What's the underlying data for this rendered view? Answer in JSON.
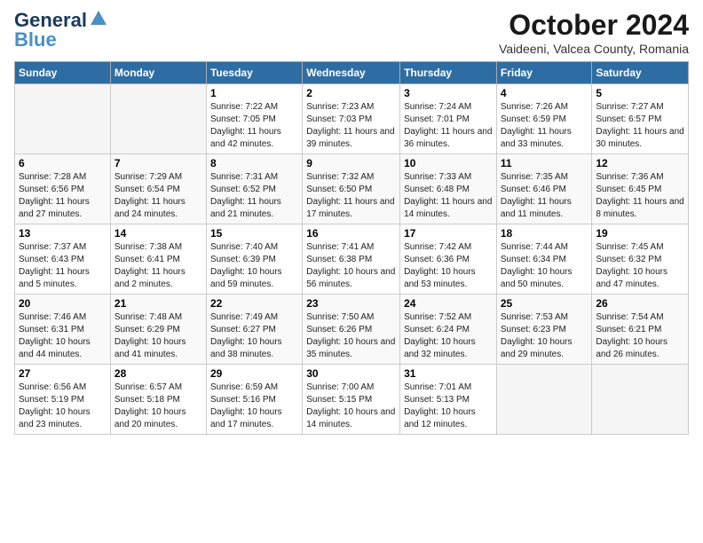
{
  "header": {
    "logo_general": "General",
    "logo_blue": "Blue",
    "month_title": "October 2024",
    "location": "Vaideeni, Valcea County, Romania"
  },
  "weekdays": [
    "Sunday",
    "Monday",
    "Tuesday",
    "Wednesday",
    "Thursday",
    "Friday",
    "Saturday"
  ],
  "weeks": [
    [
      {
        "day": "",
        "sunrise": "",
        "sunset": "",
        "daylight": ""
      },
      {
        "day": "",
        "sunrise": "",
        "sunset": "",
        "daylight": ""
      },
      {
        "day": "1",
        "sunrise": "Sunrise: 7:22 AM",
        "sunset": "Sunset: 7:05 PM",
        "daylight": "Daylight: 11 hours and 42 minutes."
      },
      {
        "day": "2",
        "sunrise": "Sunrise: 7:23 AM",
        "sunset": "Sunset: 7:03 PM",
        "daylight": "Daylight: 11 hours and 39 minutes."
      },
      {
        "day": "3",
        "sunrise": "Sunrise: 7:24 AM",
        "sunset": "Sunset: 7:01 PM",
        "daylight": "Daylight: 11 hours and 36 minutes."
      },
      {
        "day": "4",
        "sunrise": "Sunrise: 7:26 AM",
        "sunset": "Sunset: 6:59 PM",
        "daylight": "Daylight: 11 hours and 33 minutes."
      },
      {
        "day": "5",
        "sunrise": "Sunrise: 7:27 AM",
        "sunset": "Sunset: 6:57 PM",
        "daylight": "Daylight: 11 hours and 30 minutes."
      }
    ],
    [
      {
        "day": "6",
        "sunrise": "Sunrise: 7:28 AM",
        "sunset": "Sunset: 6:56 PM",
        "daylight": "Daylight: 11 hours and 27 minutes."
      },
      {
        "day": "7",
        "sunrise": "Sunrise: 7:29 AM",
        "sunset": "Sunset: 6:54 PM",
        "daylight": "Daylight: 11 hours and 24 minutes."
      },
      {
        "day": "8",
        "sunrise": "Sunrise: 7:31 AM",
        "sunset": "Sunset: 6:52 PM",
        "daylight": "Daylight: 11 hours and 21 minutes."
      },
      {
        "day": "9",
        "sunrise": "Sunrise: 7:32 AM",
        "sunset": "Sunset: 6:50 PM",
        "daylight": "Daylight: 11 hours and 17 minutes."
      },
      {
        "day": "10",
        "sunrise": "Sunrise: 7:33 AM",
        "sunset": "Sunset: 6:48 PM",
        "daylight": "Daylight: 11 hours and 14 minutes."
      },
      {
        "day": "11",
        "sunrise": "Sunrise: 7:35 AM",
        "sunset": "Sunset: 6:46 PM",
        "daylight": "Daylight: 11 hours and 11 minutes."
      },
      {
        "day": "12",
        "sunrise": "Sunrise: 7:36 AM",
        "sunset": "Sunset: 6:45 PM",
        "daylight": "Daylight: 11 hours and 8 minutes."
      }
    ],
    [
      {
        "day": "13",
        "sunrise": "Sunrise: 7:37 AM",
        "sunset": "Sunset: 6:43 PM",
        "daylight": "Daylight: 11 hours and 5 minutes."
      },
      {
        "day": "14",
        "sunrise": "Sunrise: 7:38 AM",
        "sunset": "Sunset: 6:41 PM",
        "daylight": "Daylight: 11 hours and 2 minutes."
      },
      {
        "day": "15",
        "sunrise": "Sunrise: 7:40 AM",
        "sunset": "Sunset: 6:39 PM",
        "daylight": "Daylight: 10 hours and 59 minutes."
      },
      {
        "day": "16",
        "sunrise": "Sunrise: 7:41 AM",
        "sunset": "Sunset: 6:38 PM",
        "daylight": "Daylight: 10 hours and 56 minutes."
      },
      {
        "day": "17",
        "sunrise": "Sunrise: 7:42 AM",
        "sunset": "Sunset: 6:36 PM",
        "daylight": "Daylight: 10 hours and 53 minutes."
      },
      {
        "day": "18",
        "sunrise": "Sunrise: 7:44 AM",
        "sunset": "Sunset: 6:34 PM",
        "daylight": "Daylight: 10 hours and 50 minutes."
      },
      {
        "day": "19",
        "sunrise": "Sunrise: 7:45 AM",
        "sunset": "Sunset: 6:32 PM",
        "daylight": "Daylight: 10 hours and 47 minutes."
      }
    ],
    [
      {
        "day": "20",
        "sunrise": "Sunrise: 7:46 AM",
        "sunset": "Sunset: 6:31 PM",
        "daylight": "Daylight: 10 hours and 44 minutes."
      },
      {
        "day": "21",
        "sunrise": "Sunrise: 7:48 AM",
        "sunset": "Sunset: 6:29 PM",
        "daylight": "Daylight: 10 hours and 41 minutes."
      },
      {
        "day": "22",
        "sunrise": "Sunrise: 7:49 AM",
        "sunset": "Sunset: 6:27 PM",
        "daylight": "Daylight: 10 hours and 38 minutes."
      },
      {
        "day": "23",
        "sunrise": "Sunrise: 7:50 AM",
        "sunset": "Sunset: 6:26 PM",
        "daylight": "Daylight: 10 hours and 35 minutes."
      },
      {
        "day": "24",
        "sunrise": "Sunrise: 7:52 AM",
        "sunset": "Sunset: 6:24 PM",
        "daylight": "Daylight: 10 hours and 32 minutes."
      },
      {
        "day": "25",
        "sunrise": "Sunrise: 7:53 AM",
        "sunset": "Sunset: 6:23 PM",
        "daylight": "Daylight: 10 hours and 29 minutes."
      },
      {
        "day": "26",
        "sunrise": "Sunrise: 7:54 AM",
        "sunset": "Sunset: 6:21 PM",
        "daylight": "Daylight: 10 hours and 26 minutes."
      }
    ],
    [
      {
        "day": "27",
        "sunrise": "Sunrise: 6:56 AM",
        "sunset": "Sunset: 5:19 PM",
        "daylight": "Daylight: 10 hours and 23 minutes."
      },
      {
        "day": "28",
        "sunrise": "Sunrise: 6:57 AM",
        "sunset": "Sunset: 5:18 PM",
        "daylight": "Daylight: 10 hours and 20 minutes."
      },
      {
        "day": "29",
        "sunrise": "Sunrise: 6:59 AM",
        "sunset": "Sunset: 5:16 PM",
        "daylight": "Daylight: 10 hours and 17 minutes."
      },
      {
        "day": "30",
        "sunrise": "Sunrise: 7:00 AM",
        "sunset": "Sunset: 5:15 PM",
        "daylight": "Daylight: 10 hours and 14 minutes."
      },
      {
        "day": "31",
        "sunrise": "Sunrise: 7:01 AM",
        "sunset": "Sunset: 5:13 PM",
        "daylight": "Daylight: 10 hours and 12 minutes."
      },
      {
        "day": "",
        "sunrise": "",
        "sunset": "",
        "daylight": ""
      },
      {
        "day": "",
        "sunrise": "",
        "sunset": "",
        "daylight": ""
      }
    ]
  ]
}
